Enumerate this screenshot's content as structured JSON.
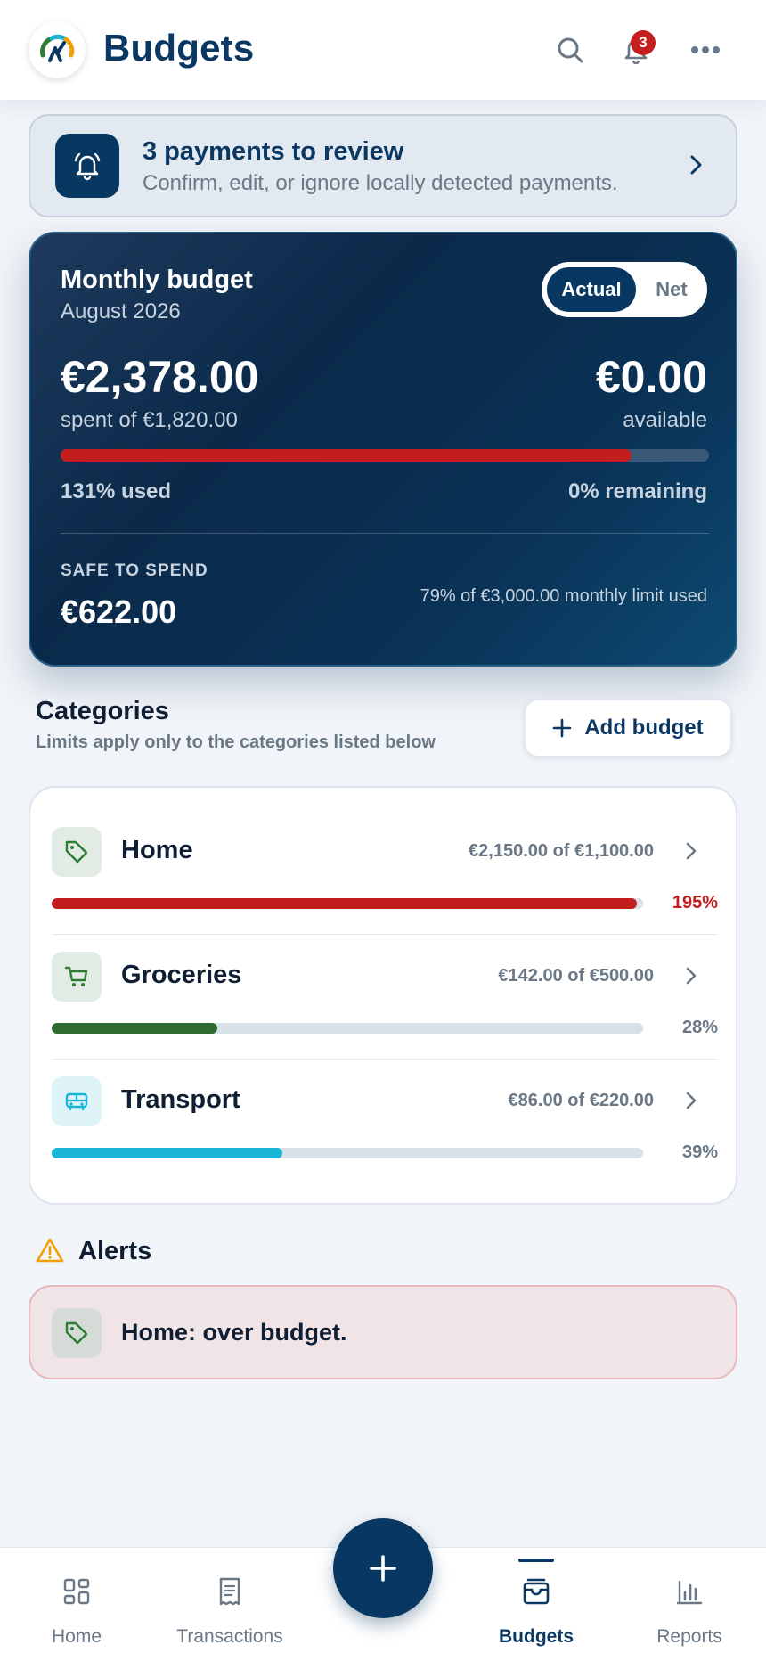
{
  "app": {
    "title": "Budgets",
    "logo_icon": "gauge-logo-icon",
    "notification_count": "3"
  },
  "review": {
    "title": "3 payments to review",
    "subtitle": "Confirm, edit, or ignore locally detected payments."
  },
  "budget": {
    "title": "Monthly budget",
    "month": "August 2026",
    "toggle": {
      "active": "Actual",
      "inactive": "Net"
    },
    "spent_amount": "€2,378.00",
    "spent_of": "spent of €1,820.00",
    "available_amount": "€0.00",
    "available_label": "available",
    "progress_fraction": 0.88,
    "used_label": "131% used",
    "remaining_label": "0% remaining",
    "safe_label": "SAFE TO SPEND",
    "safe_amount": "€622.00",
    "limit_label": "79% of €3,000.00 monthly limit used"
  },
  "categories": {
    "heading": "Categories",
    "subheading": "Limits apply only to the categories listed below",
    "add_label": "Add budget",
    "items": [
      {
        "name": "Home",
        "amount": "€2,150.00 of €1,100.00",
        "pct": "195%",
        "fill": 0.99,
        "color": "#c31e1e",
        "pct_color": "#c31e1e",
        "icon": "tag-icon",
        "icon_bg": "#e2ebe4",
        "icon_color": "#2e7d32"
      },
      {
        "name": "Groceries",
        "amount": "€142.00 of €500.00",
        "pct": "28%",
        "fill": 0.28,
        "color": "#2e6b2f",
        "pct_color": "#6a7886",
        "icon": "cart-icon",
        "icon_bg": "#e2ebe4",
        "icon_color": "#2e7d32"
      },
      {
        "name": "Transport",
        "amount": "€86.00 of €220.00",
        "pct": "39%",
        "fill": 0.39,
        "color": "#1ab4d6",
        "pct_color": "#6a7886",
        "icon": "bus-icon",
        "icon_bg": "#dff4f8",
        "icon_color": "#1ab4d6"
      }
    ]
  },
  "alerts": {
    "title": "Alerts",
    "items": [
      {
        "text": "Home: over budget.",
        "icon": "tag-icon"
      }
    ]
  },
  "nav": {
    "items": [
      {
        "label": "Home",
        "icon": "grid-icon"
      },
      {
        "label": "Transactions",
        "icon": "receipt-icon"
      },
      {
        "label": "Budgets",
        "icon": "wallet-icon",
        "active": true
      },
      {
        "label": "Reports",
        "icon": "bar-chart-icon"
      }
    ],
    "fab_icon": "plus-icon"
  }
}
